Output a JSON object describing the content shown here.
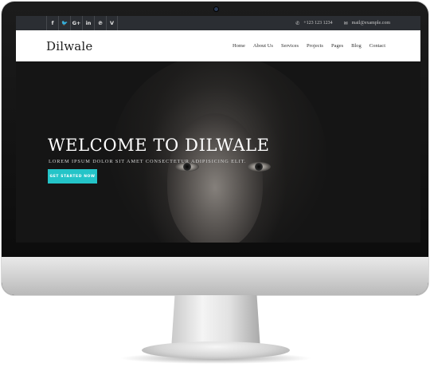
{
  "topbar": {
    "social": [
      {
        "icon": "facebook-icon",
        "glyph": "f"
      },
      {
        "icon": "twitter-icon",
        "glyph": "🐦"
      },
      {
        "icon": "google-plus-icon",
        "glyph": "G+"
      },
      {
        "icon": "linkedin-icon",
        "glyph": "in"
      },
      {
        "icon": "pinterest-icon",
        "glyph": "℗"
      },
      {
        "icon": "vine-icon",
        "glyph": "V"
      }
    ],
    "phone": "+123 123 1234",
    "email": "mail@example.com"
  },
  "navbar": {
    "brand": "Dilwale",
    "menu": [
      "Home",
      "About Us",
      "Services",
      "Projects",
      "Pages",
      "Blog",
      "Contact"
    ]
  },
  "hero": {
    "title": "WELCOME TO DILWALE",
    "subtitle": "LOREM IPSUM DOLOR SIT AMET CONSECTETUR ADIPISICING ELIT.",
    "cta_label": "GET STARTED NOW"
  },
  "colors": {
    "accent": "#24c4c8",
    "topbar": "#2b2e33",
    "nav_bg": "#ffffff"
  }
}
